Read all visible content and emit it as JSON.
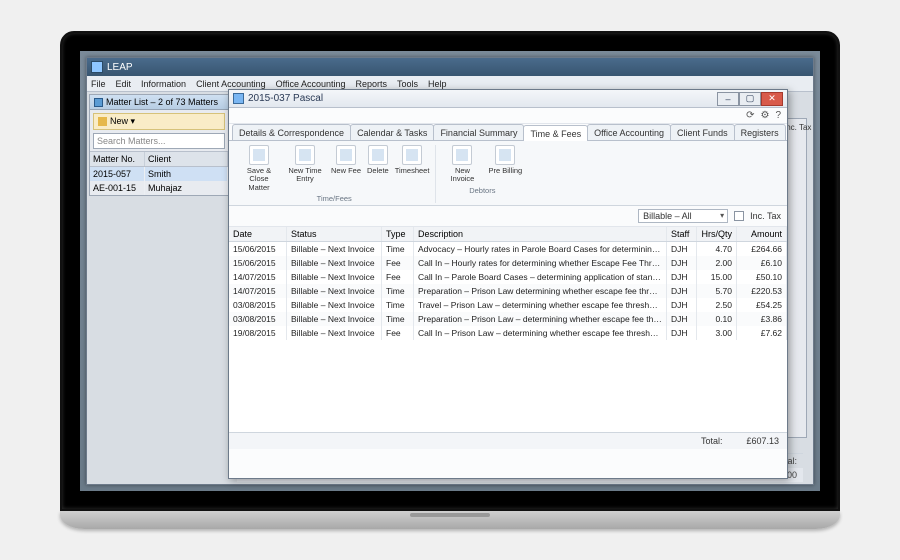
{
  "app": {
    "title": "LEAP",
    "menu": [
      "File",
      "Edit",
      "Information",
      "Client Accounting",
      "Office Accounting",
      "Reports",
      "Tools",
      "Help"
    ]
  },
  "matter_list": {
    "header": "Matter List – 2 of 73 Matters",
    "new_label": "New ▾",
    "search_placeholder": "Search Matters...",
    "columns": {
      "no": "Matter No.",
      "client": "Client"
    },
    "rows": [
      {
        "no": "2015-057",
        "client": "Smith"
      },
      {
        "no": "AE-001-15",
        "client": "Muhajaz"
      }
    ]
  },
  "right_panel": {
    "label1": "Inc. Tax"
  },
  "totals_back": {
    "label": "Total:",
    "amount": "£0.00"
  },
  "dialog": {
    "title": "2015-037 Pascal",
    "sys_icons": {
      "refresh": "⟳",
      "settings": "⚙",
      "help": "?"
    },
    "tabs": [
      "Details & Correspondence",
      "Calendar & Tasks",
      "Financial Summary",
      "Time & Fees",
      "Office Accounting",
      "Client Funds",
      "Registers"
    ],
    "active_tab": 3,
    "ribbon": {
      "groups": [
        {
          "name": "Time/Fees",
          "items": [
            {
              "label": "Save & Close Matter"
            },
            {
              "label": "New Time Entry"
            },
            {
              "label": "New Fee"
            },
            {
              "label": "Delete"
            },
            {
              "label": "Timesheet"
            }
          ]
        },
        {
          "name": "Debtors",
          "items": [
            {
              "label": "New Invoice"
            },
            {
              "label": "Pre Billing"
            }
          ]
        }
      ]
    },
    "filter": {
      "dropdown": "Billable – All",
      "inc_tax_label": "Inc. Tax"
    },
    "columns": {
      "date": "Date",
      "status": "Status",
      "type": "Type",
      "desc": "Description",
      "staff": "Staff",
      "hrs": "Hrs/Qty",
      "amount": "Amount"
    },
    "rows": [
      {
        "date": "15/06/2015",
        "status": "Billable – Next Invoice",
        "type": "Time",
        "desc": "Advocacy – Hourly rates in Parole Board Cases for determining appli…",
        "staff": "DJH",
        "hrs": "4.70",
        "amount": "£264.66"
      },
      {
        "date": "15/06/2015",
        "status": "Billable – Next Invoice",
        "type": "Fee",
        "desc": "Call In – Hourly rates for determining whether Escape Fee Threshold …",
        "staff": "DJH",
        "hrs": "2.00",
        "amount": "£6.10"
      },
      {
        "date": "14/07/2015",
        "status": "Billable – Next Invoice",
        "type": "Fee",
        "desc": "Call In – Parole Board Cases – determining application of standard f…",
        "staff": "DJH",
        "hrs": "15.00",
        "amount": "£50.10"
      },
      {
        "date": "14/07/2015",
        "status": "Billable – Next Invoice",
        "type": "Time",
        "desc": "Preparation – Prison Law determining whether escape fee threshol…",
        "staff": "DJH",
        "hrs": "5.70",
        "amount": "£220.53"
      },
      {
        "date": "03/08/2015",
        "status": "Billable – Next Invoice",
        "type": "Time",
        "desc": "Travel – Prison Law – determining whether escape fee threshold reac…",
        "staff": "DJH",
        "hrs": "2.50",
        "amount": "£54.25"
      },
      {
        "date": "03/08/2015",
        "status": "Billable – Next Invoice",
        "type": "Time",
        "desc": "Preparation – Prison Law – determining whether escape fee threshol…",
        "staff": "DJH",
        "hrs": "0.10",
        "amount": "£3.86"
      },
      {
        "date": "19/08/2015",
        "status": "Billable – Next Invoice",
        "type": "Fee",
        "desc": "Call In – Prison Law – determining whether escape fee threshold reac…",
        "staff": "DJH",
        "hrs": "3.00",
        "amount": "£7.62"
      }
    ],
    "total": {
      "label": "Total:",
      "amount": "£607.13"
    }
  }
}
